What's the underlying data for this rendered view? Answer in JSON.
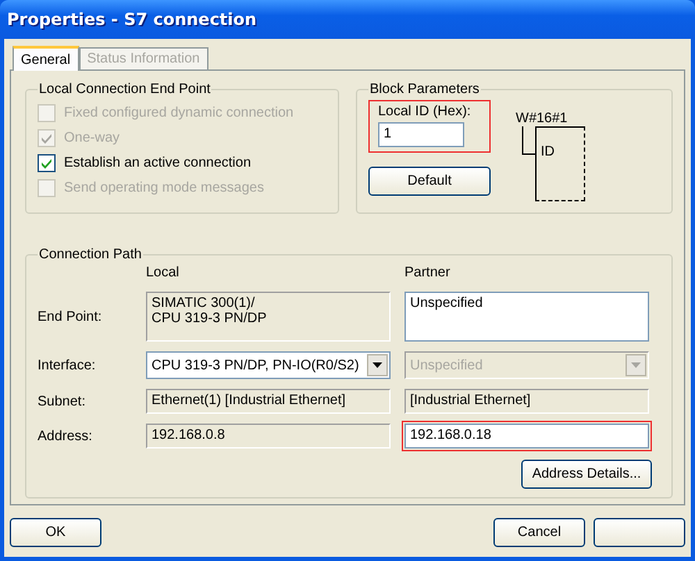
{
  "window": {
    "title": "Properties - S7 connection"
  },
  "tabs": [
    {
      "label": "General",
      "selected": true,
      "disabled": false
    },
    {
      "label": "Status Information",
      "selected": false,
      "disabled": true
    }
  ],
  "local_end_point": {
    "title": "Local Connection End Point",
    "options": [
      {
        "label": "Fixed configured dynamic connection",
        "checked": false,
        "disabled": true
      },
      {
        "label": "One-way",
        "checked": true,
        "disabled": true
      },
      {
        "label": "Establish an active connection",
        "checked": true,
        "disabled": false
      },
      {
        "label": "Send operating mode messages",
        "checked": false,
        "disabled": true
      }
    ]
  },
  "block_parameters": {
    "title": "Block Parameters",
    "local_id": {
      "label": "Local ID (Hex):",
      "value": "1",
      "highlighted": true
    },
    "default_button": "Default",
    "diagram": {
      "label": "W#16#1",
      "pin": "ID"
    }
  },
  "connection_path": {
    "title": "Connection Path",
    "columns": [
      "Local",
      "Partner"
    ],
    "rows": [
      {
        "label": "End Point:",
        "local": {
          "kind": "static",
          "value": "SIMATIC 300(1)/\nCPU 319-3 PN/DP",
          "highlighted": false
        },
        "partner": {
          "kind": "text",
          "value": "Unspecified",
          "highlighted": false
        }
      },
      {
        "label": "Interface:",
        "local": {
          "kind": "dropdown",
          "value": "CPU 319-3 PN/DP, PN-IO(R0/S2)",
          "disabled": false,
          "highlighted": false
        },
        "partner": {
          "kind": "dropdown",
          "value": "Unspecified",
          "disabled": true,
          "highlighted": false
        }
      },
      {
        "label": "Subnet:",
        "local": {
          "kind": "static",
          "value": "Ethernet(1) [Industrial Ethernet]",
          "highlighted": false
        },
        "partner": {
          "kind": "static",
          "value": "[Industrial Ethernet]",
          "highlighted": false
        }
      },
      {
        "label": "Address:",
        "local": {
          "kind": "static",
          "value": "192.168.0.8",
          "highlighted": false
        },
        "partner": {
          "kind": "text",
          "value": "192.168.0.18",
          "highlighted": true
        }
      }
    ],
    "address_details_button": "Address Details..."
  },
  "buttons": [
    {
      "label": "OK"
    },
    {
      "label": "Cancel"
    }
  ]
}
